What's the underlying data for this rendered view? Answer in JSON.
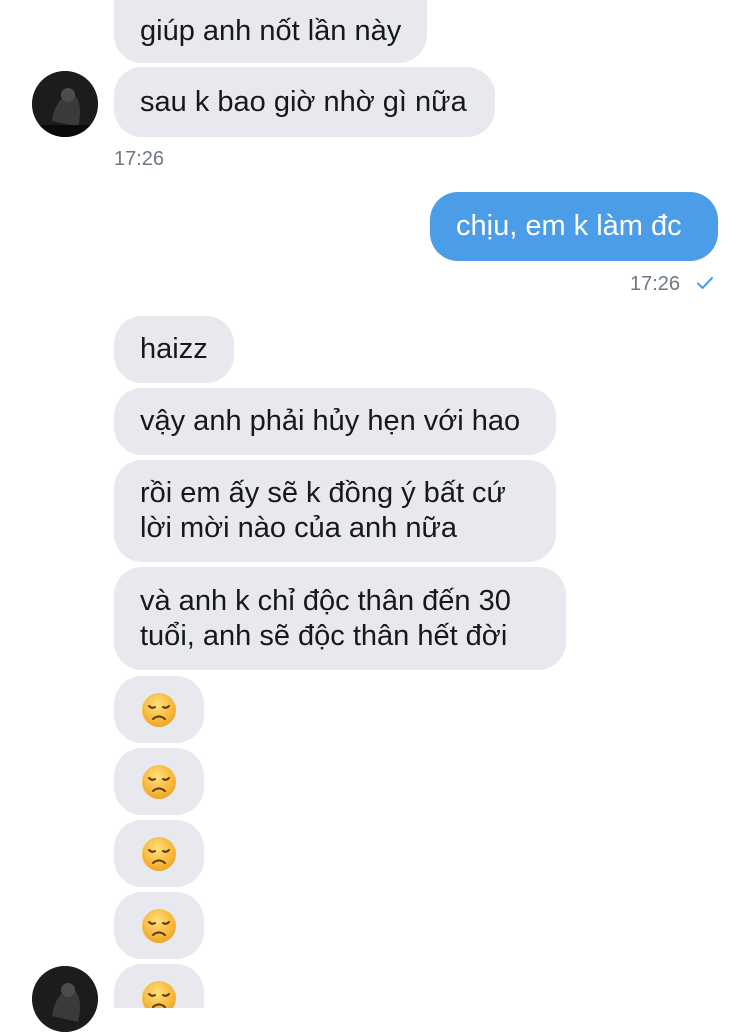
{
  "messages": {
    "m1": "giúp anh nốt lần này",
    "m2": "sau k bao giờ nhờ gì nữa",
    "ts1": "17:26",
    "m3": "chịu, em k làm đc",
    "ts2": "17:26",
    "m4": "haizz",
    "m5": "vậy anh phải hủy hẹn với hao",
    "m6": "rồi em ấy sẽ k đồng ý bất cứ\nlời mời nào của anh nữa",
    "m7": "và anh k chỉ độc thân đến 30\ntuổi, anh sẽ độc thân hết đời",
    "emoji_name": "disappointed-face-emoji"
  },
  "colors": {
    "incoming_bubble": "#e7e9ef",
    "outgoing_bubble": "#4a9de6",
    "timestamp": "#6d7883",
    "read_check": "#4a9de6",
    "emoji_face": "#f7c23c"
  }
}
